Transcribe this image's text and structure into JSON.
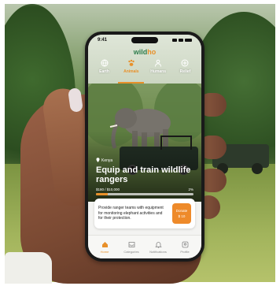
{
  "status_bar": {
    "time": "9:41"
  },
  "app": {
    "logo_prefix": "wild",
    "logo_accent": "ho"
  },
  "tabs": [
    {
      "label": "Earth",
      "icon": "globe-icon",
      "active": false
    },
    {
      "label": "Animals",
      "icon": "paw-icon",
      "active": true
    },
    {
      "label": "Humans",
      "icon": "person-icon",
      "active": false
    },
    {
      "label": "Relief",
      "icon": "relief-icon",
      "active": false
    }
  ],
  "hero": {
    "tag": "Kenya",
    "title": "Equip and train wildlife rangers",
    "progress_left": "$180 / $10,000",
    "progress_right": "2%",
    "progress_fraction": 0.12
  },
  "card": {
    "text": "Provide ranger teams with equipment for monitoring elephant activities and for their protection.",
    "button_label": "Donate",
    "button_sub": "$ 10"
  },
  "bottom_nav": [
    {
      "label": "Home",
      "icon": "home-icon",
      "active": true
    },
    {
      "label": "Categories",
      "icon": "inbox-icon",
      "active": false
    },
    {
      "label": "Notifications",
      "icon": "bell-icon",
      "active": false
    },
    {
      "label": "Profile",
      "icon": "profile-icon",
      "active": false
    }
  ],
  "colors": {
    "accent": "#e8902a",
    "brand": "#2f7d4d"
  }
}
